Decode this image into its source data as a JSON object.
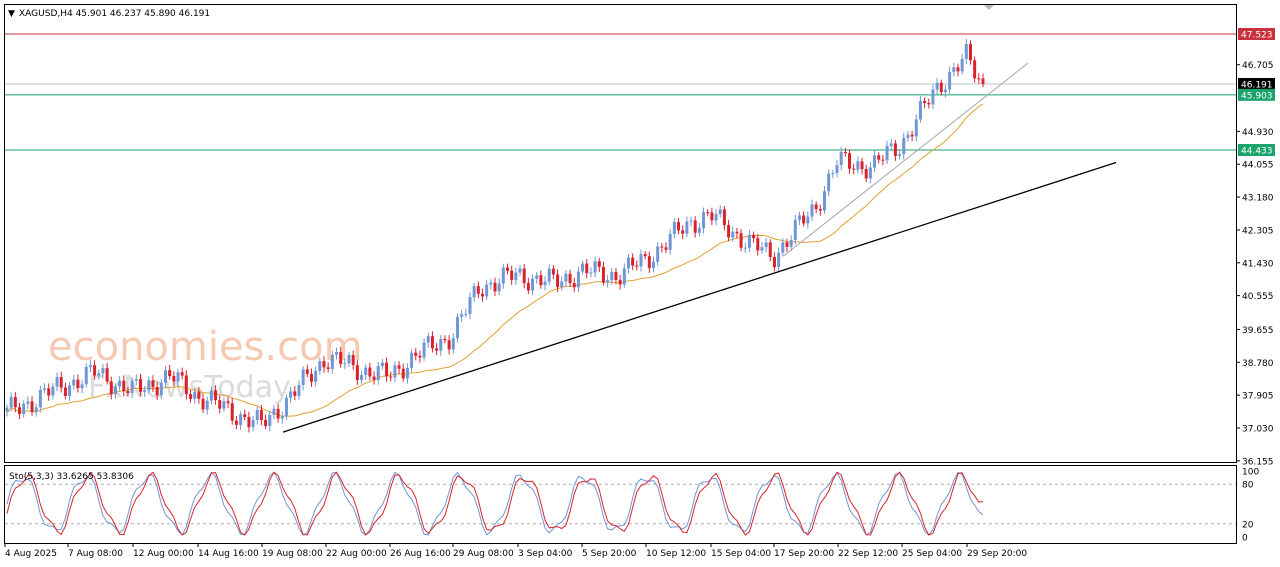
{
  "header": {
    "menu_arrow": "▼",
    "symbol_info": "XAGUSD,H4  45.901 46.237 45.890 46.191"
  },
  "watermark": {
    "brand": "economies.com",
    "sub": "FxNewsToday"
  },
  "price_axis": {
    "ticks": [
      "47.523",
      "46.705",
      "46.191",
      "45.903",
      "44.930",
      "44.433",
      "44.055",
      "43.180",
      "42.305",
      "41.430",
      "40.555",
      "39.655",
      "38.780",
      "37.905",
      "37.030",
      "36.155"
    ]
  },
  "stoch_axis": {
    "ticks": [
      "100",
      "80",
      "20",
      "0"
    ]
  },
  "time_axis": {
    "labels": [
      "4 Aug 2025",
      "7 Aug 08:00",
      "12 Aug 00:00",
      "14 Aug 16:00",
      "19 Aug 08:00",
      "22 Aug 00:00",
      "26 Aug 16:00",
      "29 Aug 08:00",
      "3 Sep 04:00",
      "5 Sep 20:00",
      "10 Sep 12:00",
      "15 Sep 04:00",
      "17 Sep 20:00",
      "22 Sep 12:00",
      "25 Sep 04:00",
      "29 Sep 20:00"
    ]
  },
  "chart_data": [
    {
      "type": "candlestick",
      "title": "XAGUSD,H4  45.901 46.237 45.890 46.191",
      "ylim": [
        36.155,
        47.9
      ],
      "colors": {
        "bull": "#6f96d6",
        "bear": "#d9222b",
        "ma": "#e0a030",
        "resistance": "#c8323c",
        "support": "#1aa36a",
        "trend": "#000000",
        "trend_light": "#a8a8a8"
      },
      "horizontal_levels": [
        {
          "value": 47.523,
          "label": "47.523",
          "color": "#c8323c"
        },
        {
          "value": 45.903,
          "label": "45.903",
          "color": "#1aa36a"
        },
        {
          "value": 44.433,
          "label": "44.433",
          "color": "#1aa36a"
        }
      ],
      "current_price": {
        "value": 46.191,
        "label": "46.191"
      },
      "trendlines": [
        {
          "from": [
            "19 Aug 08:00",
            37.0
          ],
          "to": [
            "end",
            44.1
          ]
        },
        {
          "from": [
            "17 Sep 20:00",
            41.6
          ],
          "to": [
            "end",
            46.75
          ]
        }
      ],
      "close_path": [
        [
          "4 Aug 2025",
          37.4
        ],
        [
          "7 Aug 08:00",
          38.2
        ],
        [
          "8 Aug",
          38.5
        ],
        [
          "12 Aug 00:00",
          38.0
        ],
        [
          "13 Aug",
          38.4
        ],
        [
          "14 Aug 16:00",
          37.9
        ],
        [
          "19 Aug 08:00",
          37.1
        ],
        [
          "20 Aug",
          37.9
        ],
        [
          "22 Aug 00:00",
          38.9
        ],
        [
          "25 Aug",
          38.6
        ],
        [
          "26 Aug 16:00",
          38.4
        ],
        [
          "27 Aug",
          38.9
        ],
        [
          "29 Aug 08:00",
          39.5
        ],
        [
          "1 Sep",
          40.8
        ],
        [
          "3 Sep 04:00",
          41.1
        ],
        [
          "4 Sep",
          40.9
        ],
        [
          "5 Sep 20:00",
          41.2
        ],
        [
          "8 Sep",
          41.1
        ],
        [
          "10 Sep 12:00",
          41.5
        ],
        [
          "12 Sep",
          42.5
        ],
        [
          "15 Sep 04:00",
          42.7
        ],
        [
          "16 Sep",
          41.9
        ],
        [
          "17 Sep 20:00",
          41.6
        ],
        [
          "19 Sep",
          42.9
        ],
        [
          "22 Sep 12:00",
          44.1
        ],
        [
          "24 Sep",
          44.0
        ],
        [
          "25 Sep 04:00",
          44.6
        ],
        [
          "26 Sep",
          46.2
        ],
        [
          "29 Sep 20:00",
          46.9
        ],
        [
          "end",
          46.191
        ]
      ]
    },
    {
      "type": "line",
      "title": "Sto(5,3,3) 33.6265 53.8306",
      "ylim": [
        0,
        100
      ],
      "levels": [
        80,
        20
      ],
      "series": [
        {
          "color": "#6f96d6",
          "last": 33.6265
        },
        {
          "color": "#d9222b",
          "last": 53.8306
        }
      ]
    }
  ]
}
